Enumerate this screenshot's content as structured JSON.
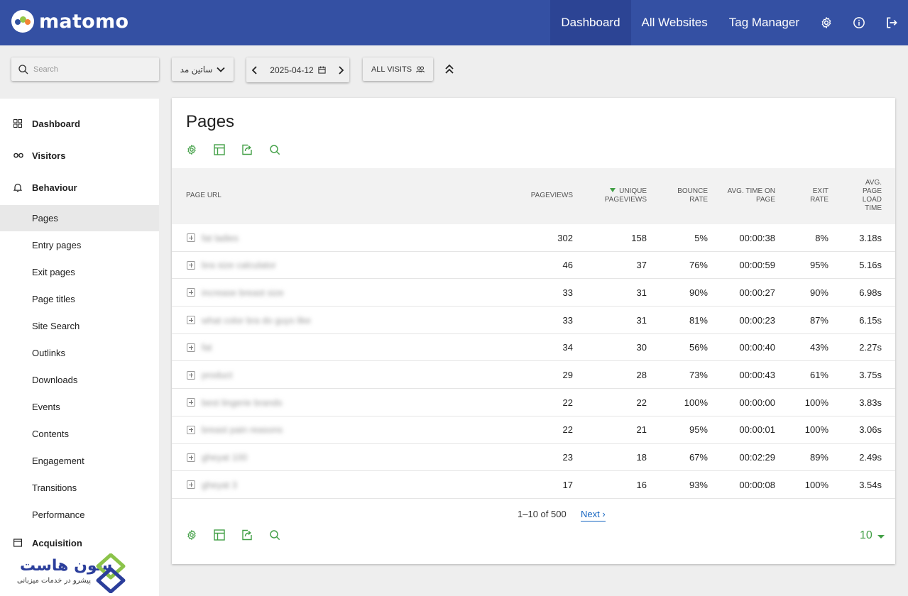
{
  "app": {
    "logo_text": "matomo"
  },
  "topnav": {
    "dashboard": "Dashboard",
    "all_websites": "All Websites",
    "tag_manager": "Tag Manager"
  },
  "controls": {
    "search_placeholder": "Search",
    "site": "ساتین مد",
    "date": "2025-04-12",
    "segment": "ALL VISITS"
  },
  "sidebar": {
    "sections": [
      {
        "label": "Dashboard",
        "icon": "dashboard-icon"
      },
      {
        "label": "Visitors",
        "icon": "visitors-icon"
      },
      {
        "label": "Behaviour",
        "icon": "bell-icon"
      },
      {
        "label": "Acquisition",
        "icon": "acquisition-icon"
      }
    ],
    "behaviour_items": [
      "Pages",
      "Entry pages",
      "Exit pages",
      "Page titles",
      "Site Search",
      "Outlinks",
      "Downloads",
      "Events",
      "Contents",
      "Engagement",
      "Transitions",
      "Performance"
    ],
    "active_item": "Pages"
  },
  "report": {
    "title": "Pages",
    "columns": {
      "url": "PAGE URL",
      "pageviews": "PAGEVIEWS",
      "unique_pageviews": "UNIQUE PAGEVIEWS",
      "bounce_rate": "BOUNCE RATE",
      "avg_time": "AVG. TIME ON PAGE",
      "exit_rate": "EXIT RATE",
      "avg_load": "AVG. PAGE LOAD TIME"
    },
    "rows": [
      {
        "url": "fat ladies",
        "pageviews": "302",
        "unique": "158",
        "bounce": "5%",
        "time": "00:00:38",
        "exit": "8%",
        "load": "3.18s"
      },
      {
        "url": "bra size calculator",
        "pageviews": "46",
        "unique": "37",
        "bounce": "76%",
        "time": "00:00:59",
        "exit": "95%",
        "load": "5.16s"
      },
      {
        "url": "increase breast size",
        "pageviews": "33",
        "unique": "31",
        "bounce": "90%",
        "time": "00:00:27",
        "exit": "90%",
        "load": "6.98s"
      },
      {
        "url": "what color bra do guys like",
        "pageviews": "33",
        "unique": "31",
        "bounce": "81%",
        "time": "00:00:23",
        "exit": "87%",
        "load": "6.15s"
      },
      {
        "url": "fat",
        "pageviews": "34",
        "unique": "30",
        "bounce": "56%",
        "time": "00:00:40",
        "exit": "43%",
        "load": "2.27s"
      },
      {
        "url": "product",
        "pageviews": "29",
        "unique": "28",
        "bounce": "73%",
        "time": "00:00:43",
        "exit": "61%",
        "load": "3.75s"
      },
      {
        "url": "best lingerie brands",
        "pageviews": "22",
        "unique": "22",
        "bounce": "100%",
        "time": "00:00:00",
        "exit": "100%",
        "load": "3.83s"
      },
      {
        "url": "breast pain reasons",
        "pageviews": "22",
        "unique": "21",
        "bounce": "95%",
        "time": "00:00:01",
        "exit": "100%",
        "load": "3.06s"
      },
      {
        "url": "gheyat 100",
        "pageviews": "23",
        "unique": "18",
        "bounce": "67%",
        "time": "00:02:29",
        "exit": "89%",
        "load": "2.49s"
      },
      {
        "url": "gheyat 3",
        "pageviews": "17",
        "unique": "16",
        "bounce": "93%",
        "time": "00:00:08",
        "exit": "100%",
        "load": "3.54s"
      }
    ],
    "pagination": {
      "info": "1–10 of 500",
      "next": "Next ›"
    },
    "limit": "10"
  },
  "brand": {
    "name": "سون هاست",
    "tagline": "پیشرو در خدمات میزبانی"
  },
  "colors": {
    "header": "#3450a3",
    "header_active": "#2c4494",
    "accent_green": "#43a047",
    "link_blue": "#1565c0"
  }
}
